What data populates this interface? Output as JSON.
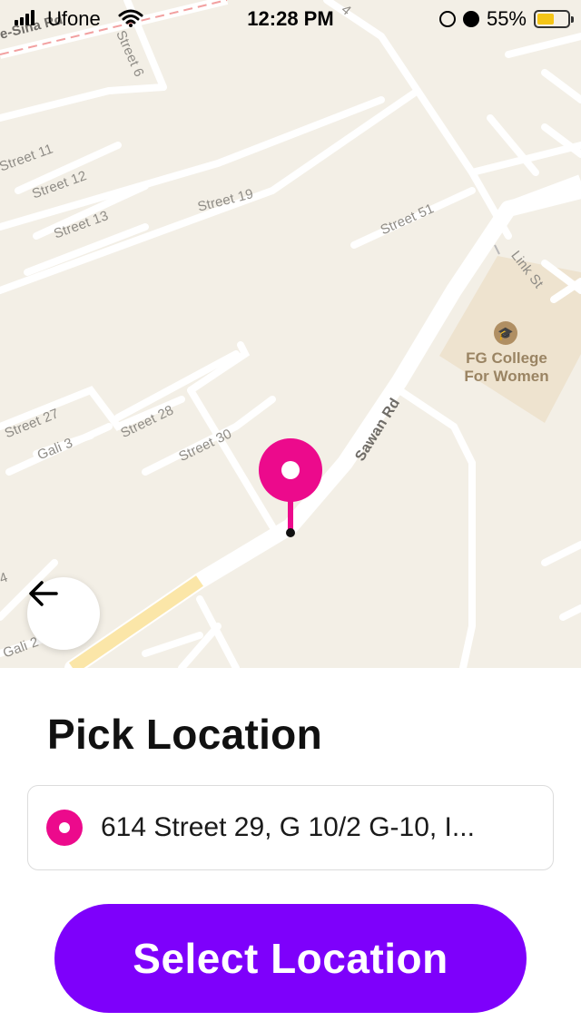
{
  "status_bar": {
    "carrier": "Ufone",
    "time": "12:28 PM",
    "battery_percent": "55%",
    "battery_level": 0.55
  },
  "map": {
    "street_labels": {
      "e_sina_rd": "e-Sina Rd",
      "street_6": "Street 6",
      "street_4": "4",
      "street_11": "Street 11",
      "street_12": "Street 12",
      "street_13": "Street 13",
      "street_19": "Street 19",
      "street_51": "Street 51",
      "link_st": "Link St",
      "sawan_rd": "Sawan Rd",
      "street_27": "Street 27",
      "gali_3": "Gali 3",
      "street_28": "Street 28",
      "street_30": "Street 30",
      "gali_2": "Gali 2",
      "left_4": "4"
    },
    "poi": {
      "name_line1": "FG College",
      "name_line2": "For Women",
      "icon": "graduation-cap-icon"
    },
    "pin_color": "#ec0a8c"
  },
  "panel": {
    "title": "Pick Location",
    "address": "614 Street 29, G 10/2 G-10, I...",
    "select_button": "Select Location",
    "accent_color": "#7e00fb"
  }
}
